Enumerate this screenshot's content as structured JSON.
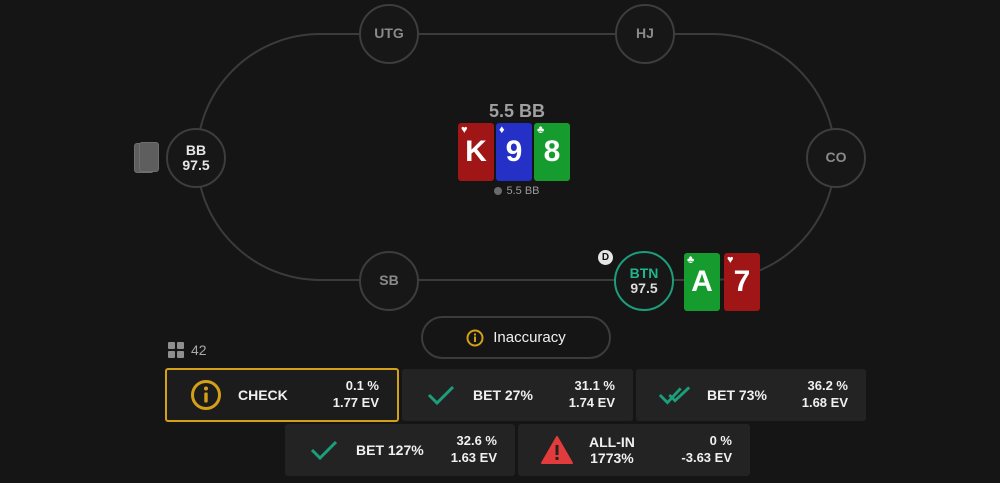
{
  "seats": {
    "utg": {
      "name": "UTG"
    },
    "hj": {
      "name": "HJ"
    },
    "co": {
      "name": "CO"
    },
    "sb": {
      "name": "SB"
    },
    "bb": {
      "name": "BB",
      "stack": "97.5"
    },
    "btn": {
      "name": "BTN",
      "stack": "97.5",
      "dealer_badge": "D"
    }
  },
  "pot": {
    "label": "5.5 BB",
    "chips_label": "5.5 BB"
  },
  "board": [
    {
      "rank": "K",
      "suit": "♥",
      "color": "#a01515"
    },
    {
      "rank": "9",
      "suit": "♦",
      "color": "#2530c7"
    },
    {
      "rank": "8",
      "suit": "♣",
      "color": "#169c2e"
    }
  ],
  "hero_cards": [
    {
      "rank": "A",
      "suit": "♣",
      "color": "#169c2e"
    },
    {
      "rank": "7",
      "suit": "♥",
      "color": "#a01515"
    }
  ],
  "feedback": {
    "label": "Inaccuracy",
    "icon": "info-circle-icon",
    "color": "#d4a017"
  },
  "combo": {
    "count": "42",
    "icon": "grid-icon"
  },
  "actions": [
    {
      "label": "CHECK",
      "freq": "0.1 %",
      "ev": "1.77 EV",
      "icon": "info-circle-icon",
      "selected": true
    },
    {
      "label": "BET 27%",
      "freq": "31.1 %",
      "ev": "1.74 EV",
      "icon": "check-icon"
    },
    {
      "label": "BET 73%",
      "freq": "36.2 %",
      "ev": "1.68 EV",
      "icon": "double-check-icon"
    },
    {
      "label": "BET 127%",
      "freq": "32.6 %",
      "ev": "1.63 EV",
      "icon": "check-icon"
    },
    {
      "label": "ALL-IN",
      "label2": "1773%",
      "freq": "0 %",
      "ev": "-3.63 EV",
      "icon": "warning-icon"
    }
  ],
  "colors": {
    "accent_teal": "#1c9e7a",
    "warning_red": "#e23b3b",
    "selected_border": "#d4a017"
  }
}
